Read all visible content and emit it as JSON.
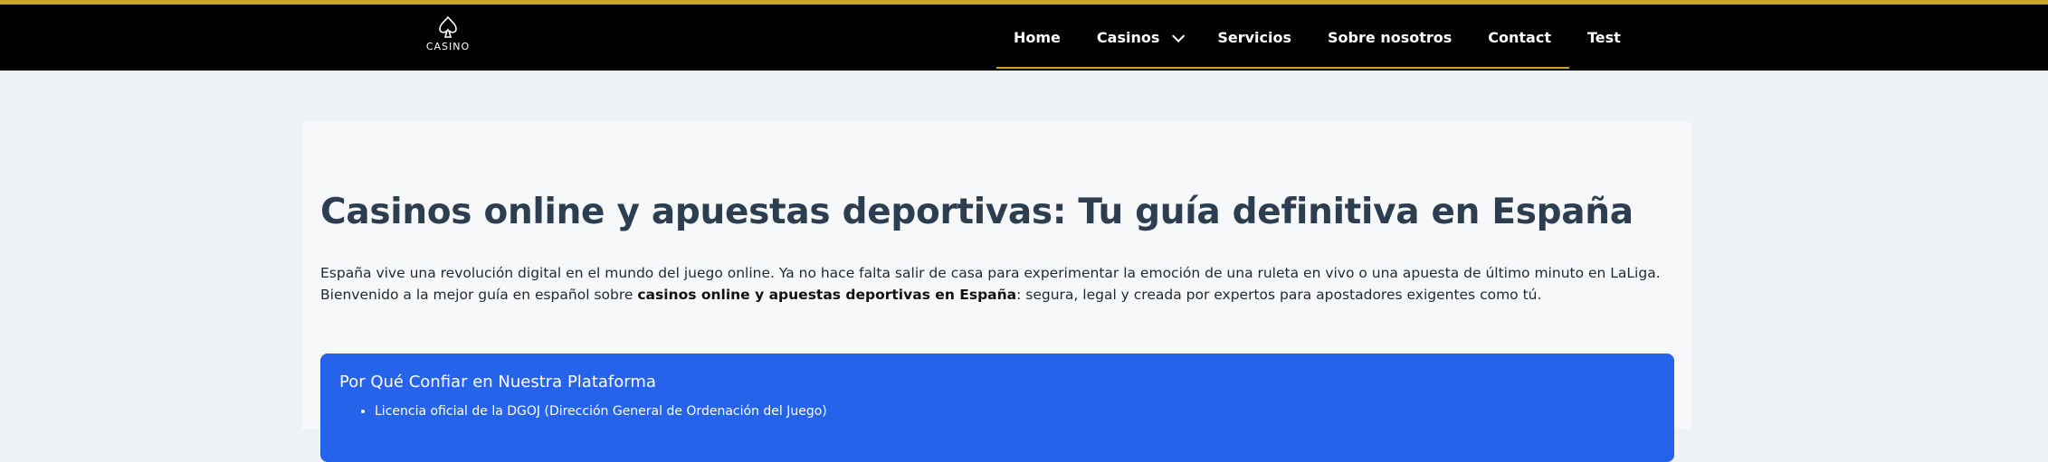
{
  "header": {
    "logo_icon": "spade-icon",
    "logo_text": "CASINO",
    "accent_color": "#c9a227"
  },
  "nav": {
    "items": [
      {
        "label": "Home"
      },
      {
        "label": "Casinos",
        "has_dropdown": true
      },
      {
        "label": "Servicios"
      },
      {
        "label": "Sobre nosotros"
      },
      {
        "label": "Contact"
      },
      {
        "label": "Test"
      }
    ]
  },
  "main": {
    "title": "Casinos online y apuestas deportivas: Tu guía definitiva en España",
    "intro_part1": "España vive una revolución digital en el mundo del juego online. Ya no hace falta salir de casa para experimentar la emoción de una ruleta en vivo o una apuesta de último minuto en LaLiga. Bienvenido a la mejor guía en español sobre ",
    "intro_bold": "casinos online y apuestas deportivas en España",
    "intro_part2": ": segura, legal y creada por expertos para apostadores exigentes como tú."
  },
  "trust_box": {
    "title": "Por Qué Confiar en Nuestra Plataforma",
    "items": [
      "Licencia oficial de la DGOJ (Dirección General de Ordenación del Juego)"
    ],
    "background_color": "#2563eb"
  }
}
